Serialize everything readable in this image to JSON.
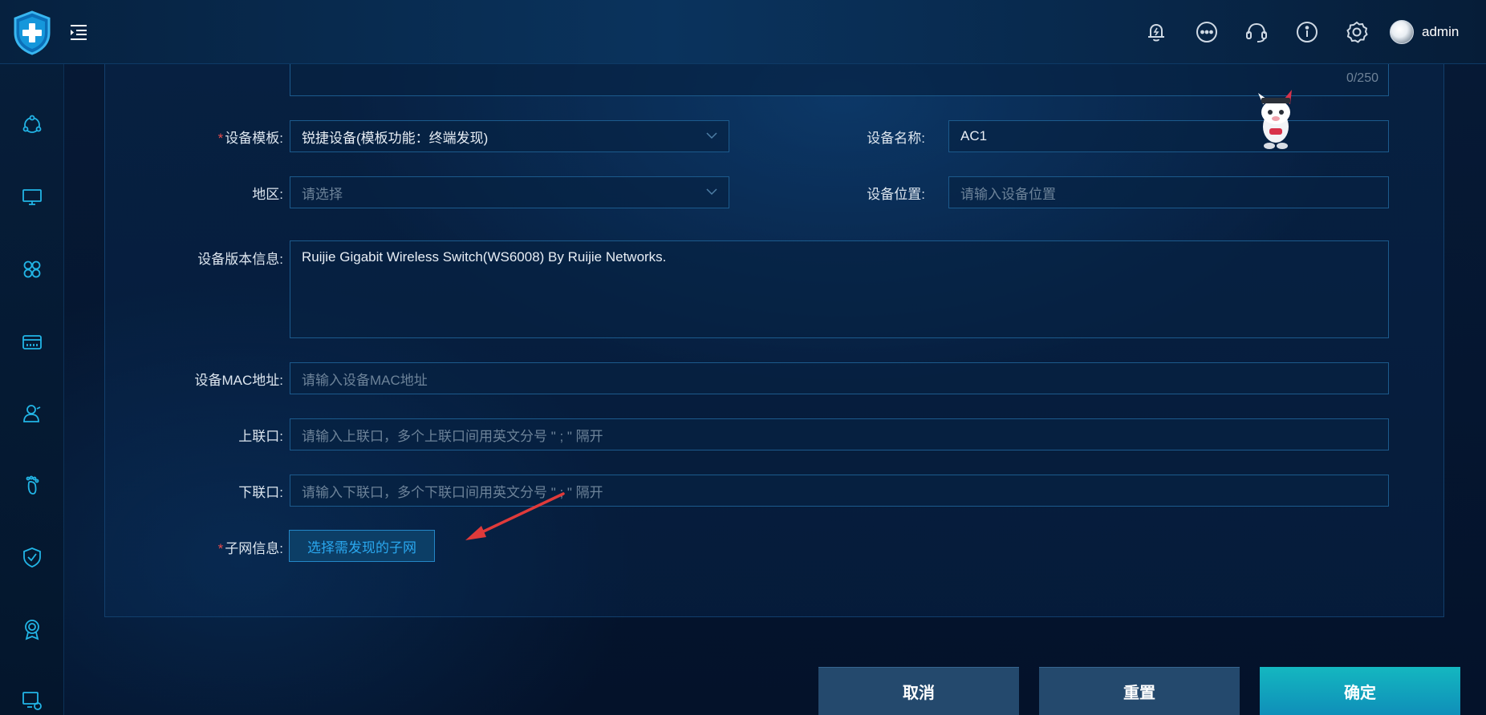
{
  "header": {
    "user_name": "admin",
    "icons": [
      "bell-icon",
      "more-icon",
      "headset-icon",
      "info-icon",
      "settings-icon"
    ]
  },
  "sidebar": {
    "items": [
      "topology-icon",
      "monitor-icon",
      "apps-icon",
      "device-icon",
      "user-icon",
      "footprint-icon",
      "shield-check-icon",
      "badge-icon",
      "screen-settings-icon"
    ]
  },
  "form": {
    "description_counter": "0/250",
    "template": {
      "label": "设备模板:",
      "value": "锐捷设备(模板功能：终端发现)"
    },
    "device_name": {
      "label": "设备名称:",
      "value": "AC1"
    },
    "region": {
      "label": "地区:",
      "placeholder": "请选择"
    },
    "location": {
      "label": "设备位置:",
      "placeholder": "请输入设备位置"
    },
    "version_info": {
      "label": "设备版本信息:",
      "value": "Ruijie Gigabit Wireless Switch(WS6008) By Ruijie Networks."
    },
    "mac": {
      "label": "设备MAC地址:",
      "placeholder": "请输入设备MAC地址"
    },
    "uplink": {
      "label": "上联口:",
      "placeholder": "请输入上联口，多个上联口间用英文分号 \" ; \" 隔开"
    },
    "downlink": {
      "label": "下联口:",
      "placeholder": "请输入下联口，多个下联口间用英文分号 \" ; \" 隔开"
    },
    "subnet": {
      "label": "子网信息:",
      "button": "选择需发现的子网"
    },
    "required_mark": "*"
  },
  "footer": {
    "cancel": "取消",
    "reset": "重置",
    "confirm": "确定"
  },
  "colors": {
    "accent": "#2aa7ee",
    "required": "#e84c4c",
    "confirm": "#14b7c0"
  }
}
